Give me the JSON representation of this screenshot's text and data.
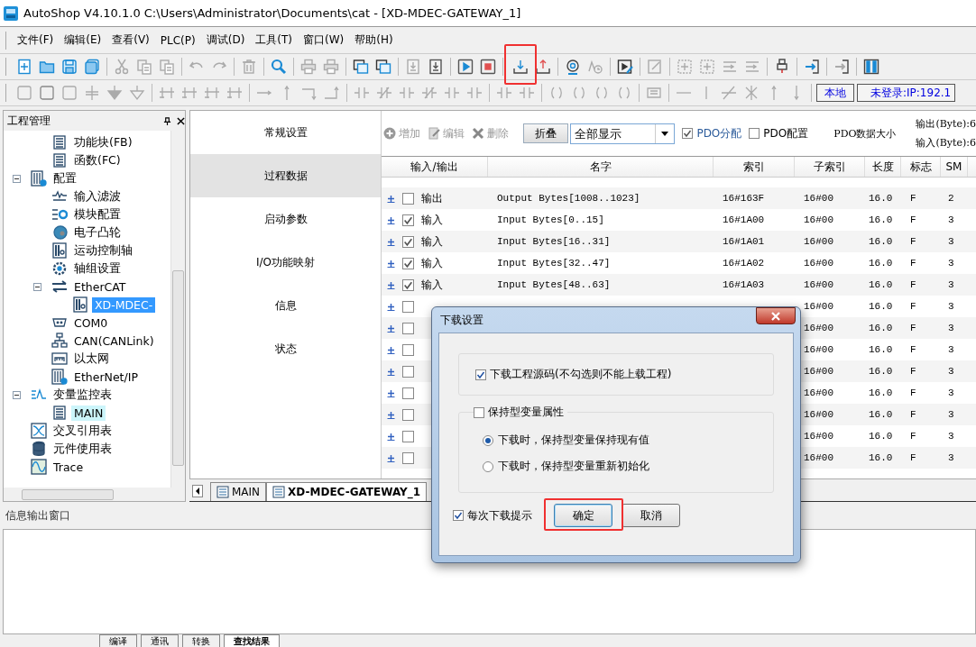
{
  "window": {
    "title": "AutoShop V4.10.1.0  C:\\Users\\Administrator\\Documents\\cat - [XD-MDEC-GATEWAY_1]"
  },
  "menu": [
    "文件(F)",
    "编辑(E)",
    "查看(V)",
    "PLC(P)",
    "调试(D)",
    "工具(T)",
    "窗口(W)",
    "帮助(H)"
  ],
  "connection": {
    "mode": "本地",
    "status": "未登录:IP:192.1"
  },
  "project_panel": {
    "title": "工程管理",
    "tree": [
      {
        "children": [
          {
            "label": "功能块(FB)",
            "selected": false
          },
          {
            "label": "函数(FC)",
            "selected": false
          }
        ]
      },
      {
        "label": "配置",
        "selected": false,
        "expanded": true,
        "children": [
          {
            "label": "输入滤波",
            "selected": false
          },
          {
            "label": "模块配置",
            "selected": false
          },
          {
            "label": "电子凸轮",
            "selected": false
          },
          {
            "label": "运动控制轴",
            "selected": false
          },
          {
            "label": "轴组设置",
            "selected": false
          },
          {
            "label": "EtherCAT",
            "selected": false,
            "expanded": true,
            "children": [
              {
                "label": "XD-MDEC-",
                "selected": true
              }
            ]
          },
          {
            "label": "COM0",
            "selected": false
          },
          {
            "label": "CAN(CANLink)",
            "selected": false
          },
          {
            "label": "以太网",
            "selected": false
          },
          {
            "label": "EtherNet/IP",
            "selected": false
          }
        ]
      },
      {
        "label": "变量监控表",
        "selected": false,
        "expanded": true,
        "children": [
          {
            "label": "MAIN",
            "selected": false,
            "highlighted": true
          }
        ]
      },
      {
        "label": "交叉引用表",
        "selected": false
      },
      {
        "label": "元件使用表",
        "selected": false
      },
      {
        "label": "Trace",
        "selected": false
      }
    ]
  },
  "nav": [
    {
      "label": "常规设置",
      "selected": false
    },
    {
      "label": "过程数据",
      "selected": true
    },
    {
      "label": "启动参数",
      "selected": false
    },
    {
      "label": "I/O功能映射",
      "selected": false
    },
    {
      "label": "信息",
      "selected": false
    },
    {
      "label": "状态",
      "selected": false
    }
  ],
  "pdo_toolbar": {
    "add": "增加",
    "edit": "编辑",
    "delete": "删除",
    "collapse": "折叠",
    "filter": "全部显示",
    "pdo_assign": {
      "label": "PDO分配",
      "checked": true
    },
    "pdo_config": {
      "label": "PDO配置",
      "checked": false
    },
    "size_label": "PDO数据大小",
    "output_size": "输出(Byte):6",
    "input_size": "输入(Byte):6"
  },
  "table": {
    "columns": [
      "输入/输出",
      "名字",
      "索引",
      "子索引",
      "长度",
      "标志",
      "SM"
    ],
    "rows": [
      {
        "checked": false,
        "io": "输出",
        "name": "Output Bytes[1008..1023]",
        "index": "16#163F",
        "sub_index": "16#00",
        "length": "16.0",
        "flag": "F",
        "sm": "2"
      },
      {
        "checked": true,
        "io": "输入",
        "name": "Input Bytes[0..15]",
        "index": "16#1A00",
        "sub_index": "16#00",
        "length": "16.0",
        "flag": "F",
        "sm": "3"
      },
      {
        "checked": true,
        "io": "输入",
        "name": "Input Bytes[16..31]",
        "index": "16#1A01",
        "sub_index": "16#00",
        "length": "16.0",
        "flag": "F",
        "sm": "3"
      },
      {
        "checked": true,
        "io": "输入",
        "name": "Input Bytes[32..47]",
        "index": "16#1A02",
        "sub_index": "16#00",
        "length": "16.0",
        "flag": "F",
        "sm": "3"
      },
      {
        "checked": true,
        "io": "输入",
        "name": "Input Bytes[48..63]",
        "index": "16#1A03",
        "sub_index": "16#00",
        "length": "16.0",
        "flag": "F",
        "sm": "3"
      },
      {
        "checked": false,
        "sub_index": "16#00",
        "length": "16.0",
        "flag": "F",
        "sm": "3"
      },
      {
        "checked": false,
        "sub_index": "16#00",
        "length": "16.0",
        "flag": "F",
        "sm": "3"
      },
      {
        "checked": false,
        "sub_index": "16#00",
        "length": "16.0",
        "flag": "F",
        "sm": "3"
      },
      {
        "checked": false,
        "sub_index": "16#00",
        "length": "16.0",
        "flag": "F",
        "sm": "3"
      },
      {
        "checked": false,
        "sub_index": "16#00",
        "length": "16.0",
        "flag": "F",
        "sm": "3"
      },
      {
        "checked": false,
        "sub_index": "16#00",
        "length": "16.0",
        "flag": "F",
        "sm": "3"
      },
      {
        "checked": false,
        "sub_index": "16#00",
        "length": "16.0",
        "flag": "F",
        "sm": "3"
      },
      {
        "checked": false,
        "sub_index": "16#00",
        "length": "16.0",
        "flag": "F",
        "sm": "3"
      }
    ]
  },
  "editor_tabs": [
    {
      "label": "MAIN",
      "selected": false
    },
    {
      "label": "XD-MDEC-GATEWAY_1",
      "selected": true
    }
  ],
  "output_panel": {
    "title": "信息输出窗口",
    "tabs": [
      {
        "label": "编译",
        "selected": false
      },
      {
        "label": "通讯",
        "selected": false
      },
      {
        "label": "转换",
        "selected": false
      },
      {
        "label": "查找结果",
        "selected": true
      }
    ]
  },
  "dialog": {
    "title": "下载设置",
    "download_source": {
      "label": "下载工程源码(不勾选则不能上载工程)",
      "checked": true
    },
    "retain_group": {
      "label": "保持型变量属性",
      "checked": false
    },
    "retain_options": [
      {
        "label": "下载时，保持型变量保持现有值",
        "selected": true
      },
      {
        "label": "下载时，保持型变量重新初始化",
        "selected": false
      }
    ],
    "prompt_each_time": {
      "label": "每次下载提示",
      "checked": true
    },
    "ok": "确定",
    "cancel": "取消"
  }
}
